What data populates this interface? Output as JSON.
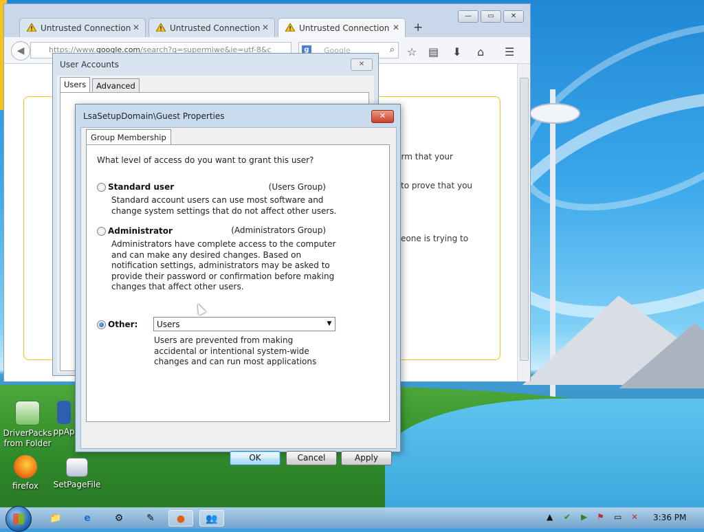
{
  "firefox": {
    "tabs": [
      {
        "label": "Untrusted Connection"
      },
      {
        "label": "Untrusted Connection"
      },
      {
        "label": "Untrusted Connection"
      }
    ],
    "new_tab_label": "+",
    "url_prefix": "https://www.",
    "url_domain": "google.com",
    "url_rest": "/search?q=supermiwe&ie=utf-8&c",
    "search_placeholder": "Google",
    "page_text": {
      "line1": "firm that your",
      "line2": "to prove that you",
      "line3": "eone is trying to"
    }
  },
  "user_accounts": {
    "title": "User Accounts",
    "tabs": [
      "Users",
      "Advanced"
    ]
  },
  "dialog": {
    "title": "LsaSetupDomain\\Guest Properties",
    "tab": "Group Membership",
    "question": "What level of access do you want to grant this user?",
    "options": [
      {
        "label": "Standard user",
        "group": "(Users Group)",
        "description": "Standard account users can use most software and change system settings that do not affect other users.",
        "selected": false
      },
      {
        "label": "Administrator",
        "group": "(Administrators Group)",
        "description": "Administrators have complete access to the computer and can make any desired changes. Based on notification settings, administrators may be asked to provide their password or confirmation before making changes that affect other users.",
        "selected": false
      },
      {
        "label": "Other:",
        "selected": true,
        "select_value": "Users",
        "description": "Users are prevented from making accidental or intentional system-wide changes and can run most applications"
      }
    ],
    "buttons": {
      "ok": "OK",
      "cancel": "Cancel",
      "apply": "Apply"
    }
  },
  "desktop_icons": [
    {
      "label": "DriverPacks from Folder",
      "icon": "driverpacks-icon"
    },
    {
      "label": "ppAp",
      "icon": "app-icon"
    },
    {
      "label": "firefox",
      "icon": "firefox-icon"
    },
    {
      "label": "SetPageFile",
      "icon": "setpagefile-icon"
    }
  ],
  "taskbar": {
    "clock": "3:36 PM"
  },
  "colors": {
    "accent": "#3c7fb1",
    "warning_border": "#f0c30c",
    "close_red": "#c9402a"
  }
}
